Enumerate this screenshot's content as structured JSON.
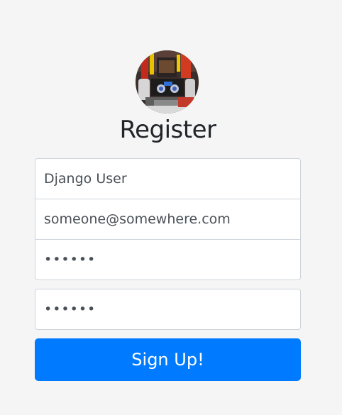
{
  "form": {
    "title": "Register",
    "username_value": "Django User",
    "email_value": "someone@somewhere.com",
    "password_mask": "••••••",
    "confirm_password_mask": "••••••",
    "submit_label": "Sign Up!"
  },
  "colors": {
    "background": "#f5f5f5",
    "accent": "#007bff",
    "field_border": "#ced4da",
    "title_text": "#212529",
    "field_text": "#495057"
  },
  "icons": {
    "avatar": "robot-photo-avatar"
  }
}
